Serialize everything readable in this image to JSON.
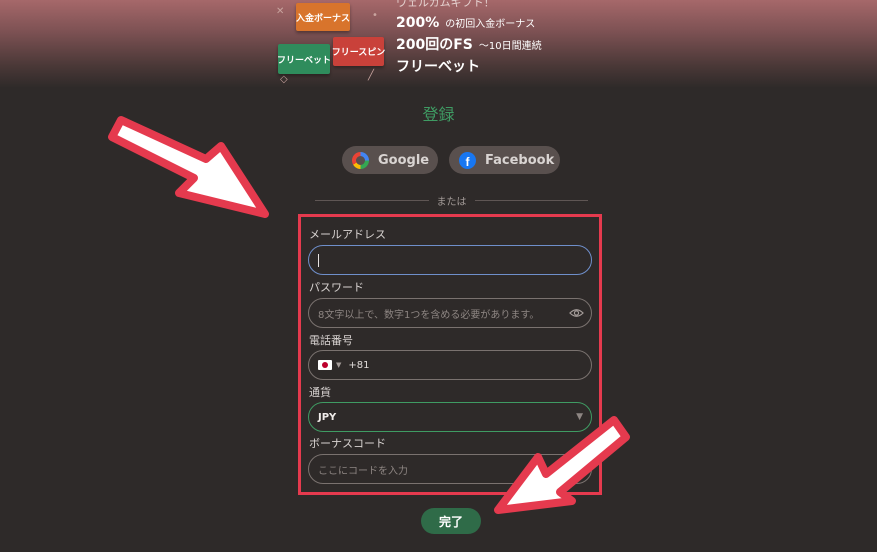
{
  "banner": {
    "top_text": "ウェルカムギフト！",
    "badges": {
      "orange": "入金ボーナス",
      "green": "フリーベット",
      "red": "フリースピン"
    },
    "line1_big": "200%",
    "line1_small": "の初回入金ボーナス",
    "line2_big": "200回のFS",
    "line2_small": "～10日間連続",
    "line3_big": "フリーベット"
  },
  "register": {
    "title": "登録",
    "google_label": "Google",
    "facebook_label": "Facebook",
    "divider_text": "または",
    "email_label": "メールアドレス",
    "email_value": "",
    "password_label": "パスワード",
    "password_placeholder": "8文字以上で、数字1つを含める必要があります。",
    "phone_label": "電話番号",
    "phone_code": "+81",
    "currency_label": "通貨",
    "currency_value": "JPY",
    "bonus_label": "ボーナスコード",
    "bonus_placeholder": "ここにコードを入力",
    "submit_label": "完了"
  },
  "icons": {
    "google": "google-logo-icon",
    "facebook": "facebook-logo-icon",
    "eye": "eye-icon",
    "flag": "japan-flag-icon",
    "dropdown": "caret-down-icon",
    "arrows": "red-pointer-arrow-icon"
  },
  "colors": {
    "accent_green": "#3f9b63",
    "submit_green": "#2f6b48",
    "highlight_red": "#e53a4e",
    "background": "#2e2a29"
  }
}
